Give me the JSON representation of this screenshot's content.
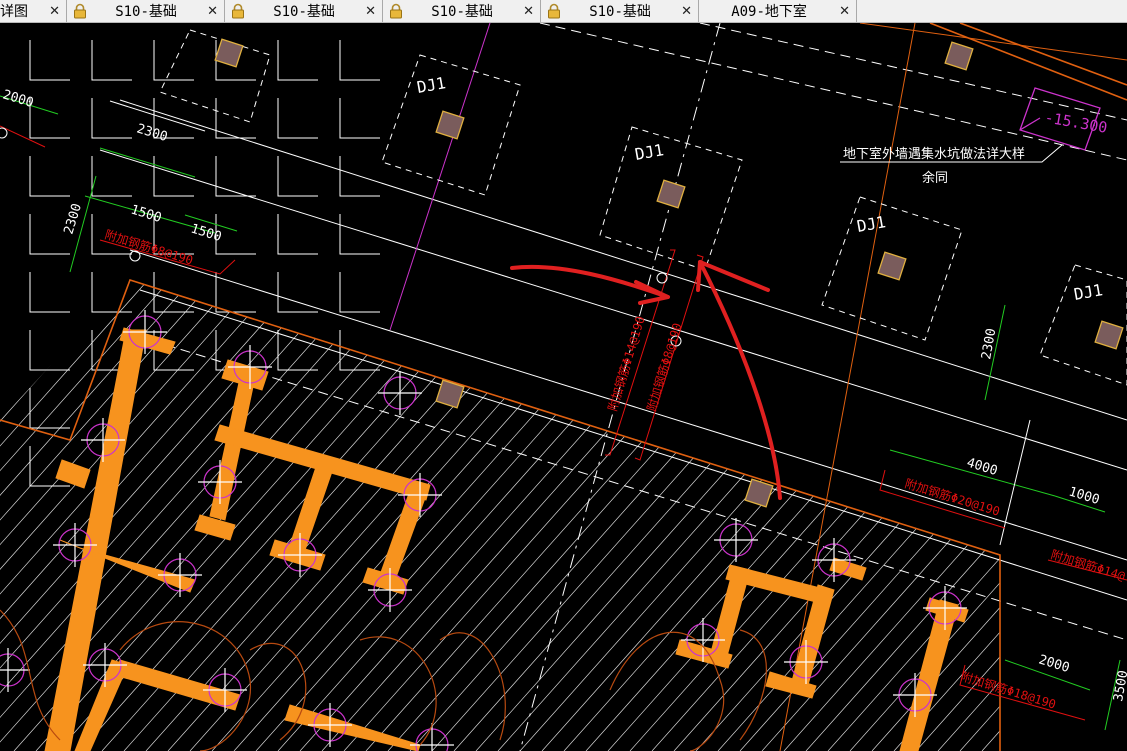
{
  "tabs": [
    {
      "label": "详图",
      "locked": false,
      "closable": true
    },
    {
      "label": "S10-基础",
      "locked": true,
      "closable": true
    },
    {
      "label": "S10-基础",
      "locked": true,
      "closable": true
    },
    {
      "label": "S10-基础",
      "locked": true,
      "closable": true
    },
    {
      "label": "S10-基础",
      "locked": true,
      "closable": true
    },
    {
      "label": "A09-地下室",
      "locked": false,
      "closable": true
    }
  ],
  "close_glyph": "✕",
  "drawing": {
    "foundation_labels": {
      "dj1_a": "DJ1",
      "dj1_b": "DJ1",
      "dj1_c": "DJ1",
      "dj1_d": "DJ1"
    },
    "note_main": "地下室外墙遇集水坑做法详大样",
    "note_sub": "余同",
    "elevation": "-15.300",
    "dims": {
      "d2000_top": "2000",
      "d2300_a": "2300",
      "d2300_b": "2300",
      "d1500_a": "1500",
      "d1500_b": "1500",
      "d2300_right": "2300",
      "d4000": "4000",
      "d1000": "1000",
      "d2000_right": "2000",
      "d3500": "3500"
    },
    "rebar": {
      "r_left": "附加钢筋Φ8@190",
      "r_mid1": "附加钢筋Φ14@190",
      "r_mid2": "附加钢筋Φ8@190",
      "r_right1": "附加钢筋Φ20@190",
      "r_right2": "附加钢筋Φ14@",
      "r_right3": "附加钢筋Φ18@190"
    }
  },
  "colors": {
    "background": "#000000",
    "wall": "#f7931e",
    "column_fill": "#7a5c5c",
    "column_border": "#e0b040",
    "magenta": "#cc33cc",
    "red": "#e01010",
    "green": "#22cc22",
    "white": "#ffffff",
    "orange_line": "#e06010",
    "annotation": "#e02020"
  }
}
